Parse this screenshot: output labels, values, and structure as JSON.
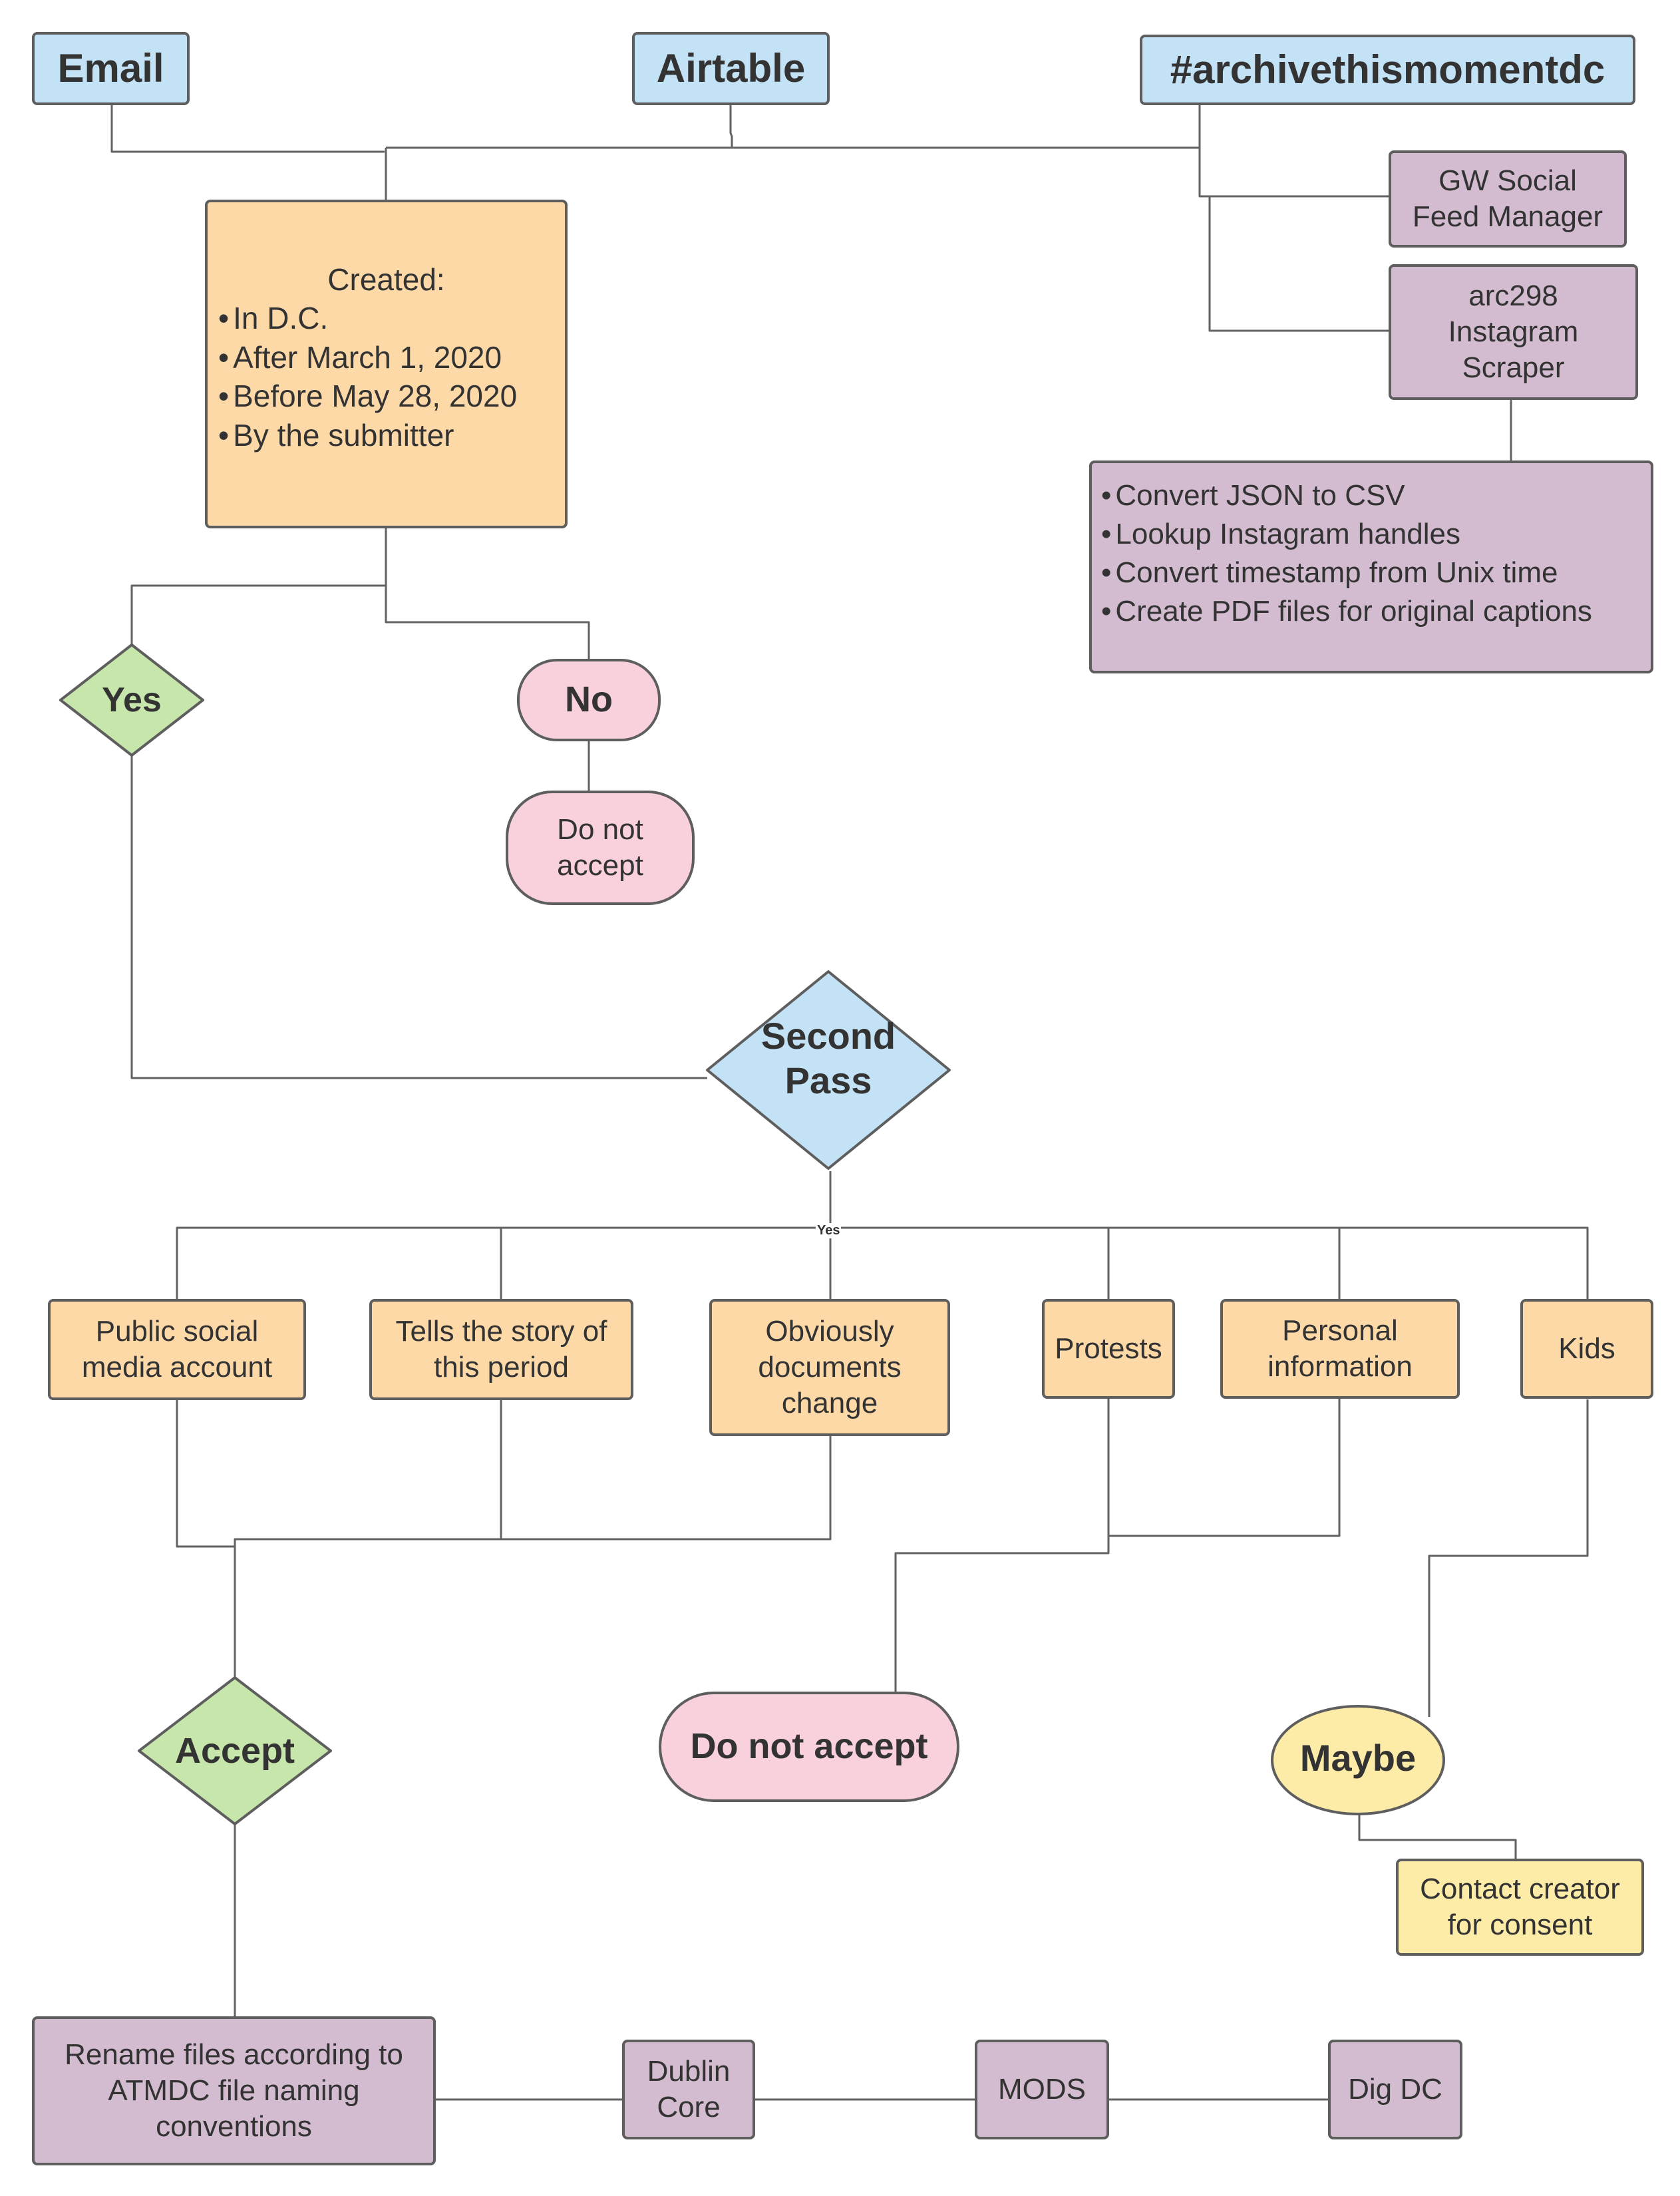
{
  "diagram": {
    "sources": {
      "email": "Email",
      "airtable": "Airtable",
      "hashtag": "#archivethismomentdc"
    },
    "tools": {
      "gw_sfm": "GW Social Feed Manager",
      "arc298": "arc298 Instagram Scraper",
      "processing_steps": [
        "Convert JSON to CSV",
        "Lookup Instagram handles",
        "Convert timestamp from Unix time",
        "Create PDF files for original captions"
      ]
    },
    "criteria": {
      "title": "Created:",
      "items": [
        "In D.C.",
        "After March 1, 2020",
        "Before May 28, 2020",
        "By the submitter"
      ]
    },
    "first_decision": {
      "yes": "Yes",
      "no": "No",
      "no_result": "Do not accept"
    },
    "second_pass": {
      "label": "Second Pass",
      "edge_label": "Yes",
      "categories": [
        "Public social media account",
        "Tells the story of this period",
        "Obviously documents change",
        "Protests",
        "Personal information",
        "Kids"
      ]
    },
    "outcomes": {
      "accept": "Accept",
      "do_not_accept": "Do not accept",
      "maybe": "Maybe",
      "maybe_action": "Contact creator for consent"
    },
    "pipeline": [
      "Rename files according to ATMDC file naming conventions",
      "Dublin Core",
      "MODS",
      "Dig DC"
    ],
    "colors": {
      "source_blue": "#c3e2f5",
      "criteria_orange": "#fdd9a8",
      "tool_purple": "#d3bccf",
      "reject_pink": "#f8d1dc",
      "maybe_yellow": "#fdeba8",
      "accept_green": "#c6e6ab",
      "stroke": "#5e5e5e"
    }
  }
}
